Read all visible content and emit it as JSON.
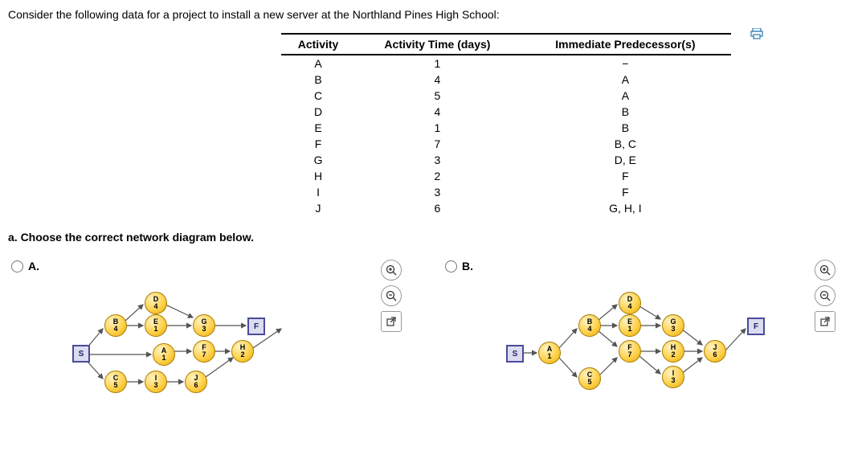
{
  "prompt": "Consider the following data for a project to install a new server at the Northland Pines High School:",
  "table": {
    "headers": [
      "Activity",
      "Activity Time (days)",
      "Immediate Predecessor(s)"
    ],
    "rows": [
      {
        "activity": "A",
        "time": "1",
        "pred": "−"
      },
      {
        "activity": "B",
        "time": "4",
        "pred": "A"
      },
      {
        "activity": "C",
        "time": "5",
        "pred": "A"
      },
      {
        "activity": "D",
        "time": "4",
        "pred": "B"
      },
      {
        "activity": "E",
        "time": "1",
        "pred": "B"
      },
      {
        "activity": "F",
        "time": "7",
        "pred": "B, C"
      },
      {
        "activity": "G",
        "time": "3",
        "pred": "D, E"
      },
      {
        "activity": "H",
        "time": "2",
        "pred": "F"
      },
      {
        "activity": "I",
        "time": "3",
        "pred": "F"
      },
      {
        "activity": "J",
        "time": "6",
        "pred": "G, H, I"
      }
    ]
  },
  "question_a": "a. Choose the correct network diagram below.",
  "options": {
    "A": {
      "label": "A."
    },
    "B": {
      "label": "B."
    }
  },
  "nodes_A": {
    "S": "S",
    "F": "F",
    "A": {
      "a": "A",
      "d": "1"
    },
    "B": {
      "a": "B",
      "d": "4"
    },
    "C": {
      "a": "C",
      "d": "5"
    },
    "D": {
      "a": "D",
      "d": "4"
    },
    "E": {
      "a": "E",
      "d": "1"
    },
    "Ff": {
      "a": "F",
      "d": "7"
    },
    "G": {
      "a": "G",
      "d": "3"
    },
    "H": {
      "a": "H",
      "d": "2"
    },
    "I": {
      "a": "I",
      "d": "3"
    },
    "J": {
      "a": "J",
      "d": "6"
    }
  },
  "nodes_B": {
    "S": "S",
    "F": "F",
    "A": {
      "a": "A",
      "d": "1"
    },
    "B": {
      "a": "B",
      "d": "4"
    },
    "C": {
      "a": "C",
      "d": "5"
    },
    "D": {
      "a": "D",
      "d": "4"
    },
    "E": {
      "a": "E",
      "d": "1"
    },
    "Ff": {
      "a": "F",
      "d": "7"
    },
    "G": {
      "a": "G",
      "d": "3"
    },
    "H": {
      "a": "H",
      "d": "2"
    },
    "I": {
      "a": "I",
      "d": "3"
    },
    "J": {
      "a": "J",
      "d": "6"
    }
  },
  "tools": {
    "zoom_in": "⊕",
    "zoom_out": "⊖",
    "open": "↗"
  }
}
